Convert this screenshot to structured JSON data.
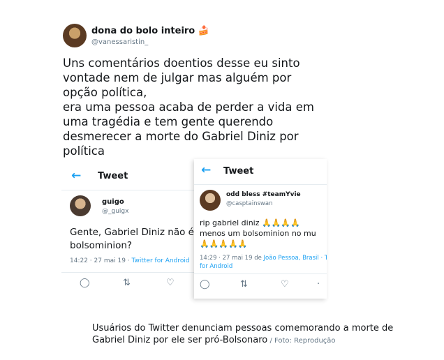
{
  "main_tweet": {
    "name": "dona do bolo inteiro 🍰",
    "handle": "@vanessaristin_",
    "text": "Uns comentários doentios desse eu sinto\nvontade nem de julgar mas alguém por\nopção política,\n era uma pessoa acaba de perder a vida em\numa tragédia e tem gente querendo\ndesmerecer a morte do Gabriel Diniz por\npolítica"
  },
  "screenshot_left": {
    "header": "Tweet",
    "name": "guigo",
    "handle": "@_guigx",
    "text": "Gente, Gabriel Diniz não é\nbolsominion?",
    "time": "14:22 · 27 mai 19 · ",
    "source": "Twitter for Android"
  },
  "screenshot_right": {
    "header": "Tweet",
    "name": "odd bless #teamYvie",
    "handle": "@casptainswan",
    "text": "rip gabriel diniz 🙏🙏🙏🙏\nmenos um bolsominion no mu\n🙏🙏🙏🙏🙏",
    "time": "14:29 · 27 mai 19 de ",
    "location": "João Pessoa, Brasil · Tw",
    "source": "for Android"
  },
  "caption": {
    "text": "Usuários do Twitter denunciam pessoas comemorando a morte de Gabriel Diniz por ele ser pró-Bolsonaro",
    "credit": " / Foto: Reprodução"
  },
  "colors": {
    "accent": "#1da1f2",
    "text": "#14171a",
    "muted": "#657786"
  }
}
